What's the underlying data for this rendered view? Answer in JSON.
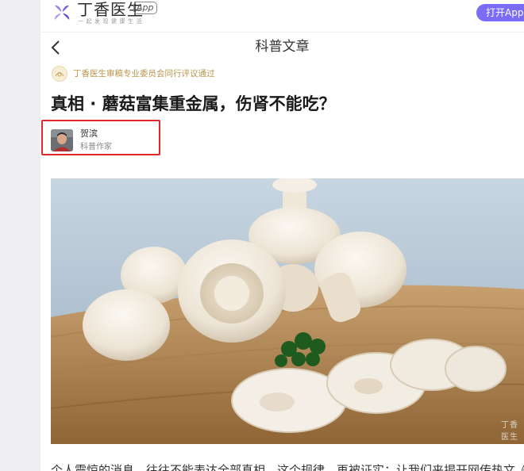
{
  "header": {
    "brand_name": "丁香医生",
    "brand_badge": "App",
    "slogan": "一起发现健康生活",
    "open_app_label": "打开App"
  },
  "nav": {
    "title": "科普文章"
  },
  "review": {
    "icon_text": "评审",
    "text": "丁香医生审稿专业委员会同行评议通过"
  },
  "article": {
    "title": "真相 · 蘑菇富集重金属，伤肾不能吃？",
    "author_name": "贺滨",
    "author_role": "科普作家",
    "watermark": "丁香医生",
    "first_line": "个人震惊的消息，往往不能表达全部真相，这个规律，再被证实：让我们来揭开网传热文《震惊"
  },
  "colors": {
    "accent": "#7b6cf6",
    "highlight_border": "#e02828",
    "review_gold": "#b8944c"
  }
}
